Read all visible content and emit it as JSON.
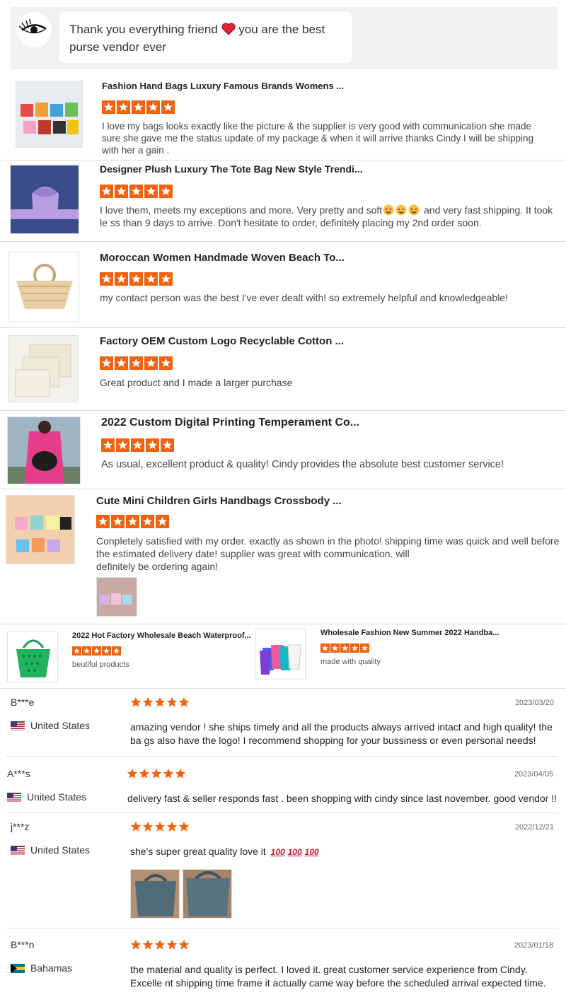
{
  "chat": {
    "message_part1": "Thank you everything friend",
    "message_part2": "you are the best purse vendor ever"
  },
  "products": [
    {
      "title": "Fashion Hand Bags Luxury Famous Brands Womens ...",
      "review": "I love my bags looks exactly like the picture & the supplier is very good with communication she made sure she gave me the status update of my package & when it will arrive thanks Cindy I will be shipping with her a gain ."
    },
    {
      "title": "Designer Plush Luxury The Tote Bag New Style Trendi...",
      "review_part1": "I love them, meets my exceptions and more. Very pretty and soft",
      "review_part2": "and very fast shipping. It took le ss than 9 days to arrive. Don't hesitate to order, definitely placing my 2nd order soon."
    },
    {
      "title": "Moroccan Women Handmade Woven Beach To...",
      "review": "my contact person was the best I've ever dealt with! so extremely helpful and knowledgeable!"
    },
    {
      "title": "Factory OEM Custom Logo Recyclable Cotton ...",
      "review": "Great product and I made a larger purchase"
    },
    {
      "title": "2022 Custom Digital Printing Temperament Co...",
      "review": "As usual, excellent product & quality! Cindy provides the absolute best customer service!"
    },
    {
      "title": "Cute Mini Children Girls Handbags Crossbody ...",
      "review_line1": "Conpletely satisfied with my order. exactly as shown in the photo! shipping time was quick and well before the estimated delivery date! supplier was great with communication. will",
      "review_line2": "definitely be ordering again!"
    }
  ],
  "mini_products": [
    {
      "title": "2022 Hot Factory Wholesale Beach Waterproof...",
      "review": "beutiful products"
    },
    {
      "title": "Wholesale Fashion New Summer 2022 Handba...",
      "review": "made with quality"
    }
  ],
  "buyer_reviews": [
    {
      "name": "B***e",
      "date": "2023/03/20",
      "country": "United States",
      "text": "amazing vendor ! she ships timely and all the products always arrived intact and high quality! the ba gs also have the logo! I recommend shopping for your bussiness or even personal needs!"
    },
    {
      "name": "A***s",
      "date": "2023/04/05",
      "country": "United States",
      "text": "delivery fast & seller responds fast . been shopping with cindy since last november. good vendor !!"
    },
    {
      "name": "j***z",
      "date": "2022/12/21",
      "country": "United States",
      "text": "she's super great quality love it"
    },
    {
      "name": "B***n",
      "date": "2023/01/18",
      "country": "Bahamas",
      "text": "the material and quality is perfect. I loved it. great customer service experience from Cindy. Excelle nt shipping time frame it actually came way before the scheduled arrival expected time."
    }
  ],
  "rating": {
    "stars": 5,
    "max": 5
  },
  "colors": {
    "star": "#f0620f",
    "heart": "#e0253c",
    "divider": "#dcdcdc",
    "chat_bg": "#f1f1f1"
  },
  "icons": {
    "star": "star-icon",
    "heart": "heart-emoji",
    "heart_eyes": "heart-eyes-emoji",
    "hundred": "hundred-points-emoji",
    "flag_us": "us-flag-icon",
    "flag_bs": "bahamas-flag-icon"
  }
}
